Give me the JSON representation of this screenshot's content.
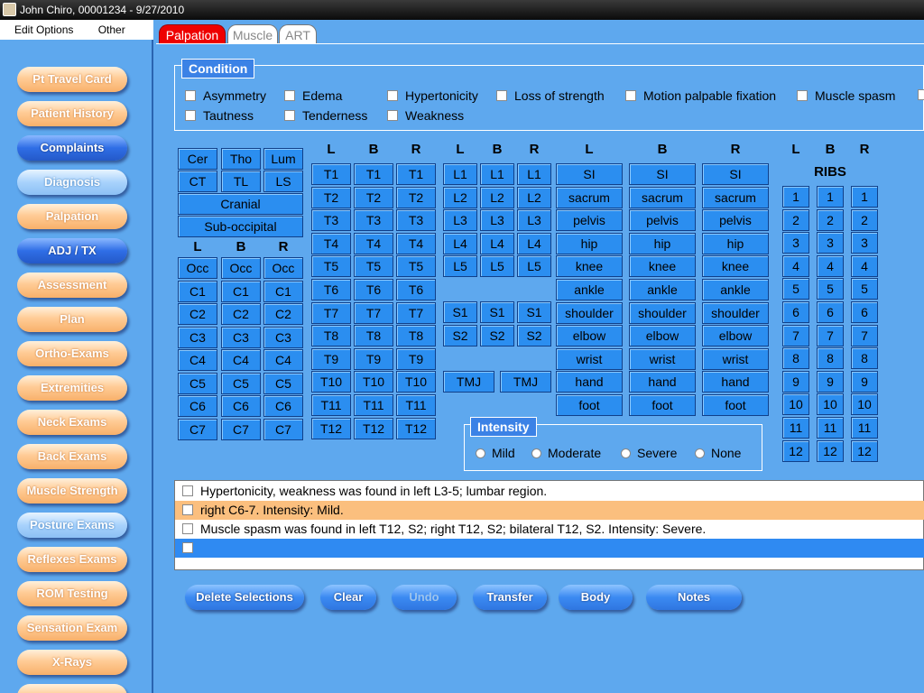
{
  "window": {
    "title": "John Chiro, 00001234 - 9/27/2010"
  },
  "menu": [
    "Edit Options",
    "Other"
  ],
  "nav": [
    {
      "label": "Pt Travel Card",
      "style": "peach"
    },
    {
      "label": "Patient History",
      "style": "peach"
    },
    {
      "label": "Complaints",
      "style": "blue"
    },
    {
      "label": "Diagnosis",
      "style": "light"
    },
    {
      "label": "Palpation",
      "style": "peach"
    },
    {
      "label": "ADJ / TX",
      "style": "blue"
    },
    {
      "label": "Assessment",
      "style": "peach"
    },
    {
      "label": "Plan",
      "style": "peach"
    },
    {
      "label": "Ortho-Exams",
      "style": "peach"
    },
    {
      "label": "Extremities",
      "style": "peach"
    },
    {
      "label": "Neck Exams",
      "style": "peach"
    },
    {
      "label": "Back Exams",
      "style": "peach"
    },
    {
      "label": "Muscle Strength",
      "style": "peach"
    },
    {
      "label": "Posture Exams",
      "style": "light"
    },
    {
      "label": "Reflexes Exams",
      "style": "peach"
    },
    {
      "label": "ROM Testing",
      "style": "peach"
    },
    {
      "label": "Sensation Exam",
      "style": "peach"
    },
    {
      "label": "X-Rays",
      "style": "peach"
    }
  ],
  "tabs": [
    "Palpation",
    "Muscle",
    "ART"
  ],
  "condition": {
    "label": "Condition",
    "row1": [
      "Asymmetry",
      "Edema",
      "Hypertonicity",
      "Loss of strength",
      "Motion palpable fixation",
      "Muscle spasm"
    ],
    "row2": [
      "Tautness",
      "Tenderness",
      "Weakness"
    ]
  },
  "region": {
    "row1": [
      "Cer",
      "Tho",
      "Lum"
    ],
    "row2": [
      "CT",
      "TL",
      "LS"
    ],
    "cranial": "Cranial",
    "suboccipital": "Sub-occipital"
  },
  "lbr": [
    "L",
    "B",
    "R"
  ],
  "cervical": [
    "Occ",
    "C1",
    "C2",
    "C3",
    "C4",
    "C5",
    "C6",
    "C7"
  ],
  "thoracic": [
    "T1",
    "T2",
    "T3",
    "T4",
    "T5",
    "T6",
    "T7",
    "T8",
    "T9",
    "T10",
    "T11",
    "T12"
  ],
  "lumbar": [
    "L1",
    "L2",
    "L3",
    "L4",
    "L5"
  ],
  "sacral": [
    "S1",
    "S2"
  ],
  "tmj": "TMJ",
  "extremities": [
    "SI",
    "sacrum",
    "pelvis",
    "hip",
    "knee",
    "ankle",
    "shoulder",
    "elbow",
    "wrist",
    "hand",
    "foot"
  ],
  "ribs": {
    "label": "RIBS",
    "numbers": [
      "1",
      "2",
      "3",
      "4",
      "5",
      "6",
      "7",
      "8",
      "9",
      "10",
      "11",
      "12"
    ]
  },
  "intensity": {
    "label": "Intensity",
    "options": [
      "Mild",
      "Moderate",
      "Severe",
      "None"
    ]
  },
  "findings": [
    {
      "text": "Hypertonicity, weakness was found in left L3-5; lumbar region.",
      "highlight": "none"
    },
    {
      "text": "right C6-7. Intensity: Mild.",
      "highlight": "orange"
    },
    {
      "text": "Muscle spasm was found in left T12, S2; right T12, S2; bilateral T12, S2. Intensity: Severe.",
      "highlight": "none"
    },
    {
      "text": "",
      "highlight": "blue"
    }
  ],
  "actions": [
    {
      "label": "Delete Selections",
      "enabled": true
    },
    {
      "label": "Clear",
      "enabled": true
    },
    {
      "label": "Undo",
      "enabled": false
    },
    {
      "label": "Transfer",
      "enabled": true
    },
    {
      "label": "Body",
      "enabled": true
    },
    {
      "label": "Notes",
      "enabled": true
    }
  ],
  "colors": {
    "background": "#5ea8ee",
    "grid_button": "#2b8ef0",
    "active_tab": "#ee0000",
    "highlight_orange": "#fbbf7e",
    "highlight_blue": "#2f8af2"
  }
}
